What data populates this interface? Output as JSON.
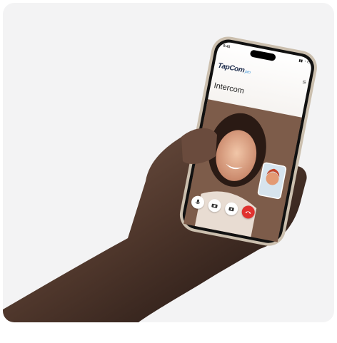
{
  "app": {
    "status_time": "9:41",
    "status_icons": "▮▮ ◔ ▭",
    "brand_name": "TapCom",
    "brand_suffix": "pro",
    "section_title": "Intercom"
  },
  "call_controls": [
    {
      "icon": "microphone-icon"
    },
    {
      "icon": "camera-icon"
    },
    {
      "icon": "door-icon"
    },
    {
      "icon": "end-call-icon"
    }
  ],
  "colors": {
    "background": "#f3f3f4",
    "end_call": "#e0322f",
    "brand": "#1b2a4a"
  }
}
